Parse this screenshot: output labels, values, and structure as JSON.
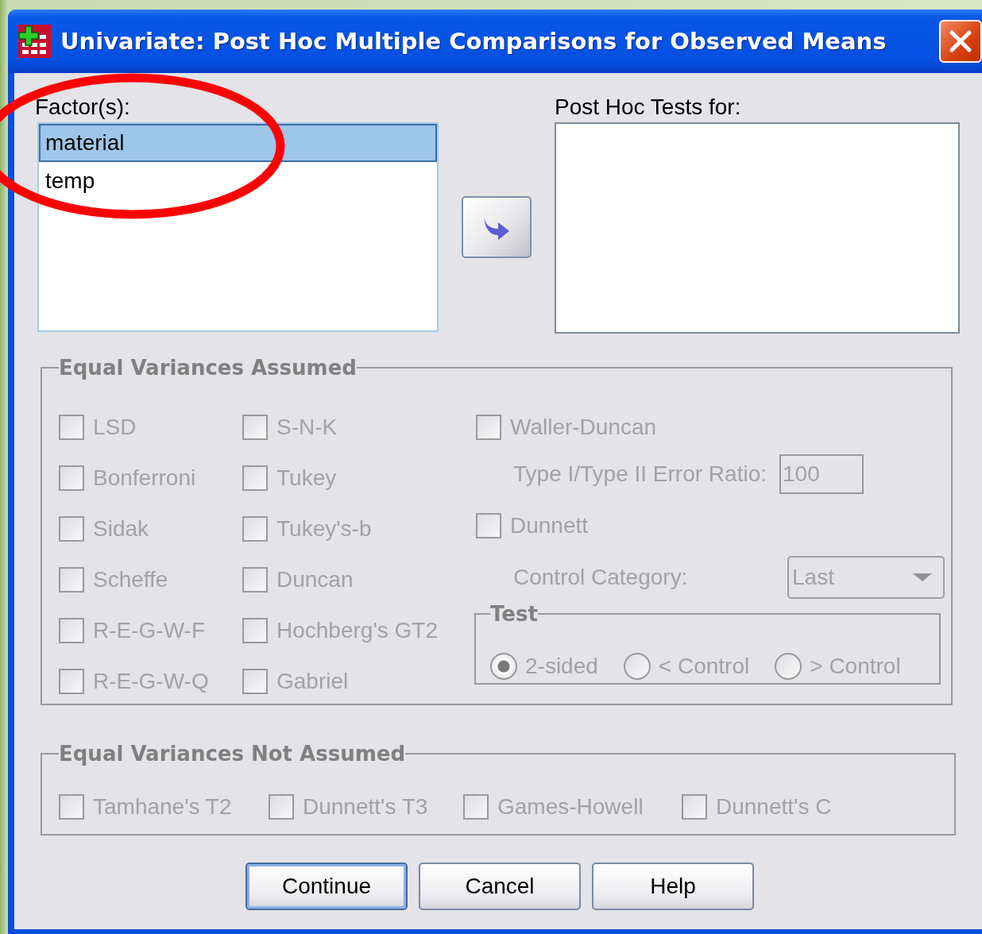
{
  "window": {
    "title": "Univariate: Post Hoc Multiple Comparisons for Observed Means"
  },
  "factors": {
    "label": "Factor(s):",
    "items": [
      {
        "label": "material",
        "selected": true
      },
      {
        "label": "temp",
        "selected": false
      }
    ]
  },
  "post_hoc_tests": {
    "label": "Post Hoc Tests for:"
  },
  "equal_variances_assumed": {
    "title": "Equal Variances Assumed",
    "disabled": true,
    "column_1": [
      {
        "label": "LSD",
        "checked": false
      },
      {
        "label": "Bonferroni",
        "checked": false
      },
      {
        "label": "Sidak",
        "checked": false
      },
      {
        "label": "Scheffe",
        "checked": false
      },
      {
        "label": "R-E-G-W-F",
        "checked": false
      },
      {
        "label": "R-E-G-W-Q",
        "checked": false
      }
    ],
    "column_2": [
      {
        "label": "S-N-K",
        "checked": false
      },
      {
        "label": "Tukey",
        "checked": false
      },
      {
        "label": "Tukey's-b",
        "checked": false
      },
      {
        "label": "Duncan",
        "checked": false
      },
      {
        "label": "Hochberg's GT2",
        "checked": false
      },
      {
        "label": "Gabriel",
        "checked": false
      }
    ],
    "waller_duncan": {
      "label": "Waller-Duncan",
      "checked": false
    },
    "error_ratio": {
      "label": "Type I/Type II Error Ratio:",
      "value": "100"
    },
    "dunnett": {
      "label": "Dunnett",
      "checked": false
    },
    "control_category": {
      "label": "Control Category:",
      "value": "Last"
    },
    "test": {
      "title": "Test",
      "options": [
        {
          "label": "2-sided",
          "selected": true
        },
        {
          "label": "< Control",
          "selected": false
        },
        {
          "label": "> Control",
          "selected": false
        }
      ]
    }
  },
  "equal_variances_not_assumed": {
    "title": "Equal Variances Not Assumed",
    "disabled": true,
    "items": [
      {
        "label": "Tamhane's T2",
        "checked": false
      },
      {
        "label": "Dunnett's T3",
        "checked": false
      },
      {
        "label": "Games-Howell",
        "checked": false
      },
      {
        "label": "Dunnett's C",
        "checked": false
      }
    ]
  },
  "buttons": [
    {
      "label": "Continue",
      "default": true
    },
    {
      "label": "Cancel",
      "default": false
    },
    {
      "label": "Help",
      "default": false
    }
  ]
}
